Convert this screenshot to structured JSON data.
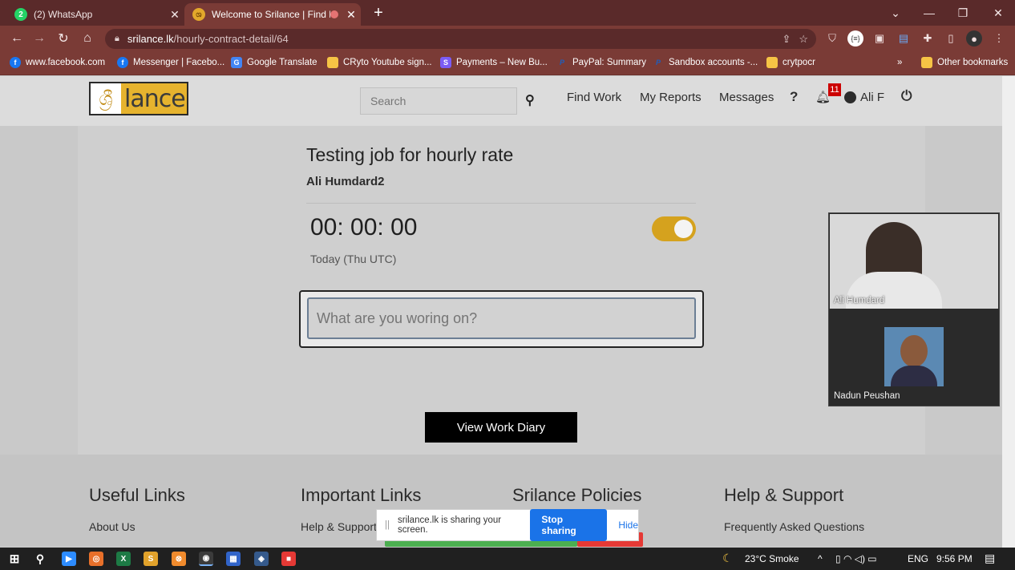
{
  "browser": {
    "tabs": [
      {
        "label": "(2) WhatsApp",
        "favicon": "whatsapp-icon",
        "active": false
      },
      {
        "label": "Welcome to Srilance | Find D",
        "favicon": "srilance-icon",
        "active": true
      }
    ],
    "url_host": "srilance.lk",
    "url_path": "/hourly-contract-detail/64",
    "bookmarks": [
      "www.facebook.com",
      "Messenger | Facebo...",
      "Google Translate",
      "CRyto Youtube sign...",
      "Payments – New Bu...",
      "PayPal: Summary",
      "Sandbox accounts -...",
      "crytpocr"
    ],
    "other_bookmarks": "Other bookmarks",
    "more_bookmarks": "»"
  },
  "site": {
    "logo_word": "lance",
    "logo_mark": "ශ්‍රී",
    "search_placeholder": "Search",
    "nav": {
      "find_work": "Find Work",
      "my_reports": "My Reports",
      "messages": "Messages",
      "notification_count": "11",
      "user_name": "Ali F"
    }
  },
  "contract": {
    "job_title": "Testing job for hourly rate",
    "client_name": "Ali Humdard2",
    "timer": "00: 00: 00",
    "today_label": "Today (Thu UTC)",
    "task_placeholder": "What are you woring on?",
    "timer_active": true,
    "view_diary_label": "View Work Diary"
  },
  "footer": {
    "columns": [
      {
        "heading": "Useful Links",
        "first_link": "About Us"
      },
      {
        "heading": "Important Links",
        "first_link": "Help & Support"
      },
      {
        "heading": "Srilance Policies",
        "first_link": ""
      },
      {
        "heading": "Help & Support",
        "first_link": "Frequently Asked Questions"
      }
    ]
  },
  "video_call": {
    "participants": [
      "Ali Humdard",
      "Nadun Peushan"
    ]
  },
  "screen_share": {
    "message": "srilance.lk is sharing your screen.",
    "stop_label": "Stop sharing",
    "hide_label": "Hide"
  },
  "taskbar": {
    "weather": "23°C  Smoke",
    "language": "ENG",
    "time": "9:56 PM"
  },
  "colors": {
    "chrome_frame": "#5a2a2a",
    "chrome_toolbar": "#7a3b36",
    "brand_gold": "#d5a21e",
    "primary_button": "#000000",
    "share_blue": "#1a73e8"
  }
}
